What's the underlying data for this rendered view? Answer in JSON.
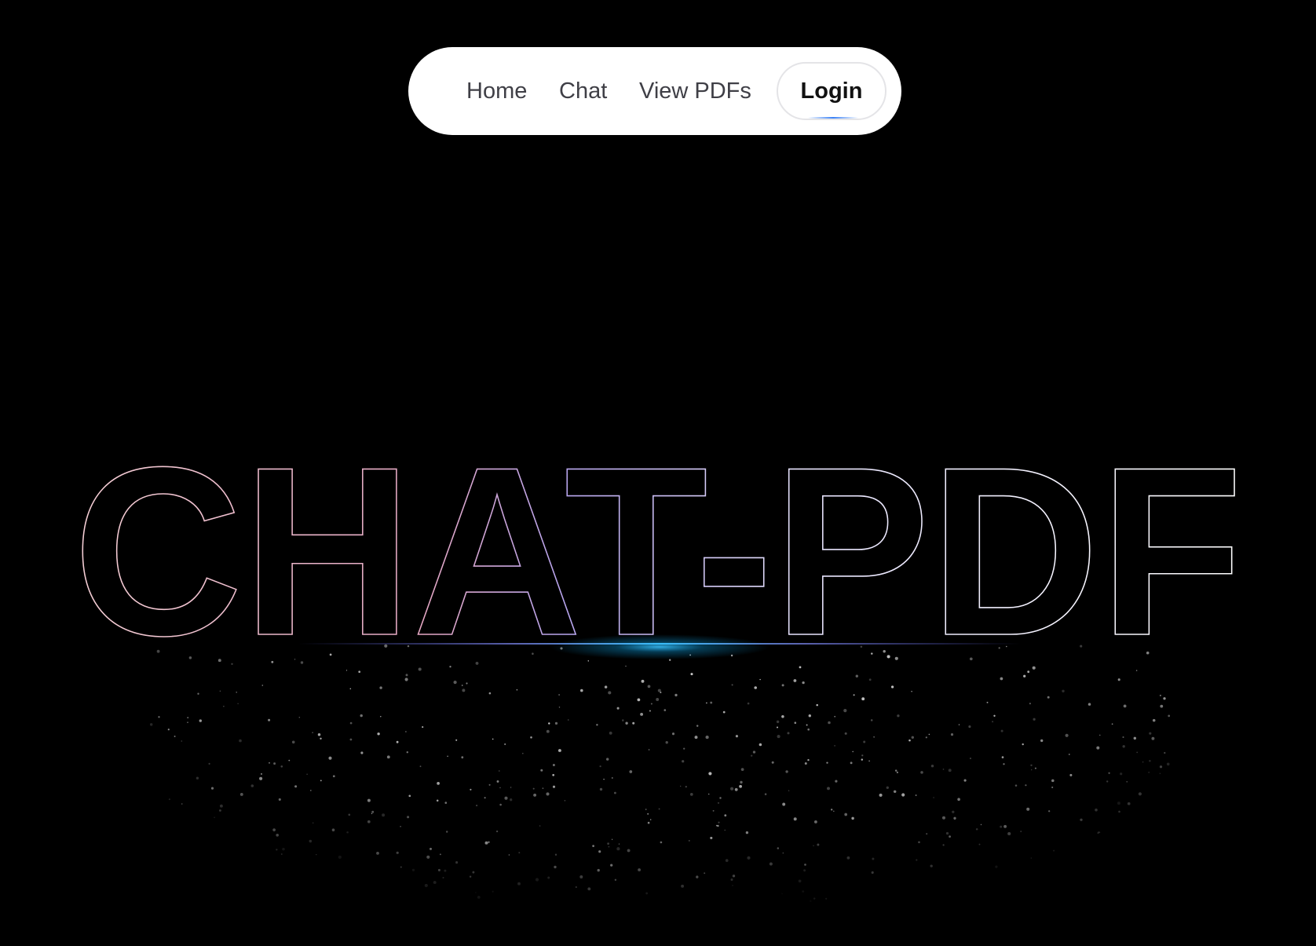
{
  "nav": {
    "items": [
      {
        "label": "Home"
      },
      {
        "label": "Chat"
      },
      {
        "label": "View PDFs"
      }
    ],
    "login_label": "Login"
  },
  "hero": {
    "title": "CHAT-PDF"
  },
  "colors": {
    "background": "#000000",
    "nav_background": "#ffffff",
    "nav_text": "#3f3f46",
    "accent_blue": "#3b82f6",
    "gradient_pink": "#f4b4c8",
    "gradient_lavender": "#c4b5fd",
    "gradient_white": "#ffffff"
  }
}
